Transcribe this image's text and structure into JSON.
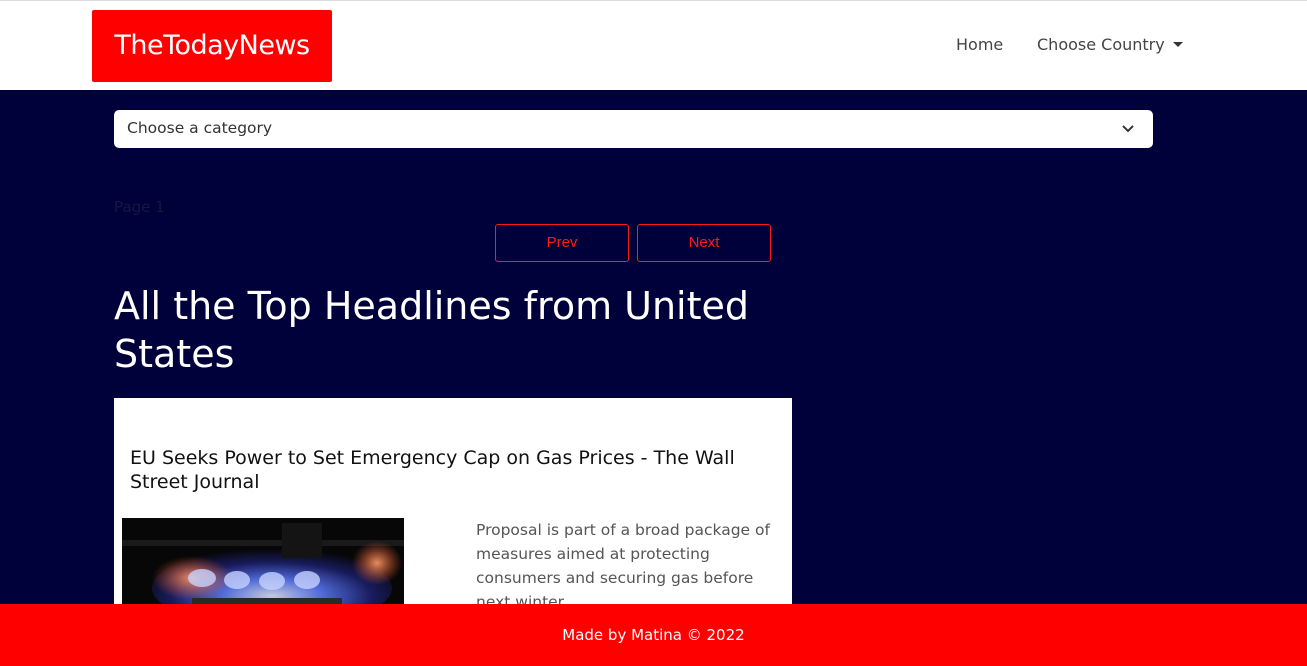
{
  "navbar": {
    "brand": "TheTodayNews",
    "links": [
      {
        "label": "Home"
      },
      {
        "label": "Choose Country"
      }
    ]
  },
  "category_select": {
    "selected": "Choose a category"
  },
  "pagination": {
    "page_label": "Page 1",
    "prev_label": "Prev",
    "next_label": "Next"
  },
  "main": {
    "heading": "All the Top Headlines from United States"
  },
  "articles": [
    {
      "title": "EU Seeks Power to Set Emergency Cap on Gas Prices - The Wall Street Journal",
      "description": "Proposal is part of a broad package of measures aimed at protecting consumers and securing gas before next winter"
    }
  ],
  "footer": {
    "text": "Made by Matina © 2022"
  },
  "colors": {
    "brand_red": "#ff0000",
    "page_background": "#00003a",
    "button_outline": "#ff1a1a"
  }
}
